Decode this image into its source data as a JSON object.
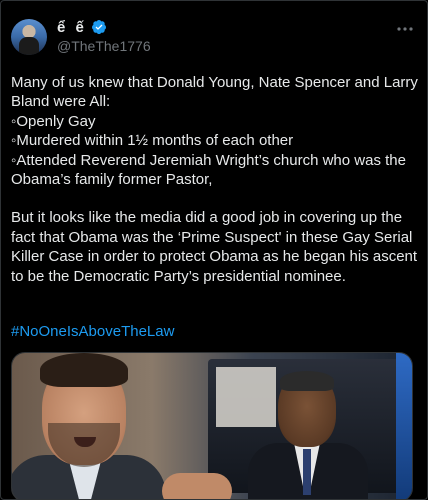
{
  "post": {
    "display_name": "ể ế",
    "handle": "@TheThe1776",
    "lines": [
      "Many of us knew that Donald Young, Nate Spencer and Larry",
      "Bland were All:",
      "◦Openly Gay",
      "◦Murdered within 1½ months of each other",
      "◦Attended Reverend Jeremiah Wright’s church who was the",
      "Obama’s family former Pastor,",
      "",
      "But it looks like the media did a good job in covering up the",
      "fact that Obama was the ‘Prime Suspect' in these Gay Serial",
      "Killer Case in order to protect Obama as he began his ascent",
      "to be the Democratic Party’s presidential nominee."
    ],
    "hashtag": "#NoOneIsAboveTheLaw"
  },
  "colors": {
    "background": "#000000",
    "text": "#e7e9ea",
    "secondary": "#71767b",
    "link": "#1d9bf0",
    "verified": "#1d9bf0"
  },
  "icons": {
    "verified": "verified-badge-icon",
    "more": "more-options-icon"
  }
}
